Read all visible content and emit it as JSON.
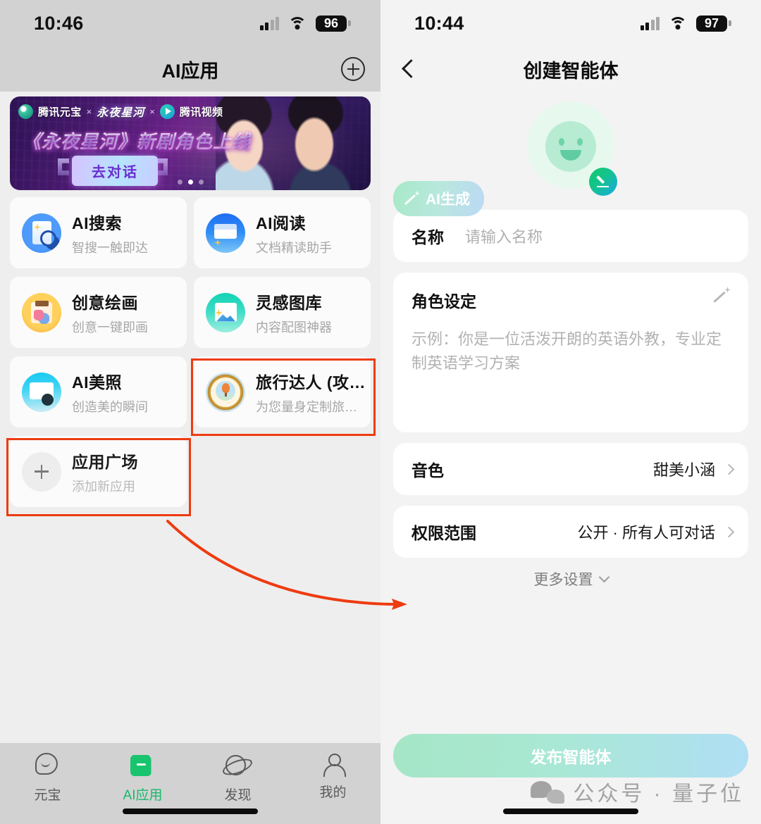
{
  "left": {
    "status": {
      "time": "10:46",
      "battery": "96",
      "signal_icon": "signal-bars-icon",
      "wifi_icon": "wifi-icon"
    },
    "nav": {
      "title": "AI应用",
      "add_icon": "plus-circle-icon"
    },
    "banner": {
      "brand": "腾讯元宝",
      "x1": "×",
      "drama": "永夜星河",
      "x2": "×",
      "partner": "腾讯视频",
      "headline": "《永夜星河》新剧角色上线",
      "cta": "去对话"
    },
    "apps": [
      {
        "title": "AI搜索",
        "sub": "智搜一触即达",
        "icon": "ai-search-icon"
      },
      {
        "title": "AI阅读",
        "sub": "文档精读助手",
        "icon": "ai-read-icon"
      },
      {
        "title": "创意绘画",
        "sub": "创意一键即画",
        "icon": "creative-draw-icon"
      },
      {
        "title": "灵感图库",
        "sub": "内容配图神器",
        "icon": "inspiration-gallery-icon"
      },
      {
        "title": "AI美照",
        "sub": "创造美的瞬间",
        "icon": "ai-photo-icon"
      },
      {
        "title": "旅行达人 (攻…",
        "sub": "为您量身定制旅…",
        "icon": "travel-expert-icon"
      },
      {
        "title": "应用广场",
        "sub": "添加新应用",
        "icon": "plus-icon"
      }
    ],
    "tabs": [
      {
        "label": "元宝",
        "icon": "chat-bubble-icon",
        "active": false
      },
      {
        "label": "AI应用",
        "icon": "bag-icon",
        "active": true
      },
      {
        "label": "发现",
        "icon": "planet-icon",
        "active": false
      },
      {
        "label": "我的",
        "icon": "user-icon",
        "active": false
      }
    ]
  },
  "right": {
    "status": {
      "time": "10:44",
      "battery": "97",
      "signal_icon": "signal-bars-icon",
      "wifi_icon": "wifi-icon"
    },
    "nav": {
      "title": "创建智能体",
      "back_icon": "chevron-left-icon"
    },
    "avatar": {
      "edit_icon": "pencil-edit-icon",
      "face_icon": "smiley-face-icon"
    },
    "ai_generate": {
      "label": "AI生成",
      "icon": "magic-wand-icon"
    },
    "name_field": {
      "label": "名称",
      "placeholder": "请输入名称",
      "value": ""
    },
    "persona_field": {
      "label": "角色设定",
      "placeholder": "示例：你是一位活泼开朗的英语外教，专业定制英语学习方案",
      "magic_icon": "magic-wand-icon"
    },
    "voice_row": {
      "label": "音色",
      "value": "甜美小涵",
      "chevron": "chevron-right-icon"
    },
    "permission_row": {
      "label": "权限范围",
      "value": "公开 · 所有人可对话",
      "chevron": "chevron-right-icon"
    },
    "more_settings": {
      "label": "更多设置",
      "icon": "chevron-down-icon"
    },
    "publish_button": {
      "label": "发布智能体"
    },
    "watermark": {
      "text": "公众号 · 量子位",
      "icon": "wechat-icon"
    }
  },
  "annotations": {
    "highlight_color": "#ee3b11",
    "boxes": [
      "travel-expert-card",
      "app-plaza-card"
    ],
    "arrow": "curved-arrow-from-app-plaza-to-more-settings"
  }
}
